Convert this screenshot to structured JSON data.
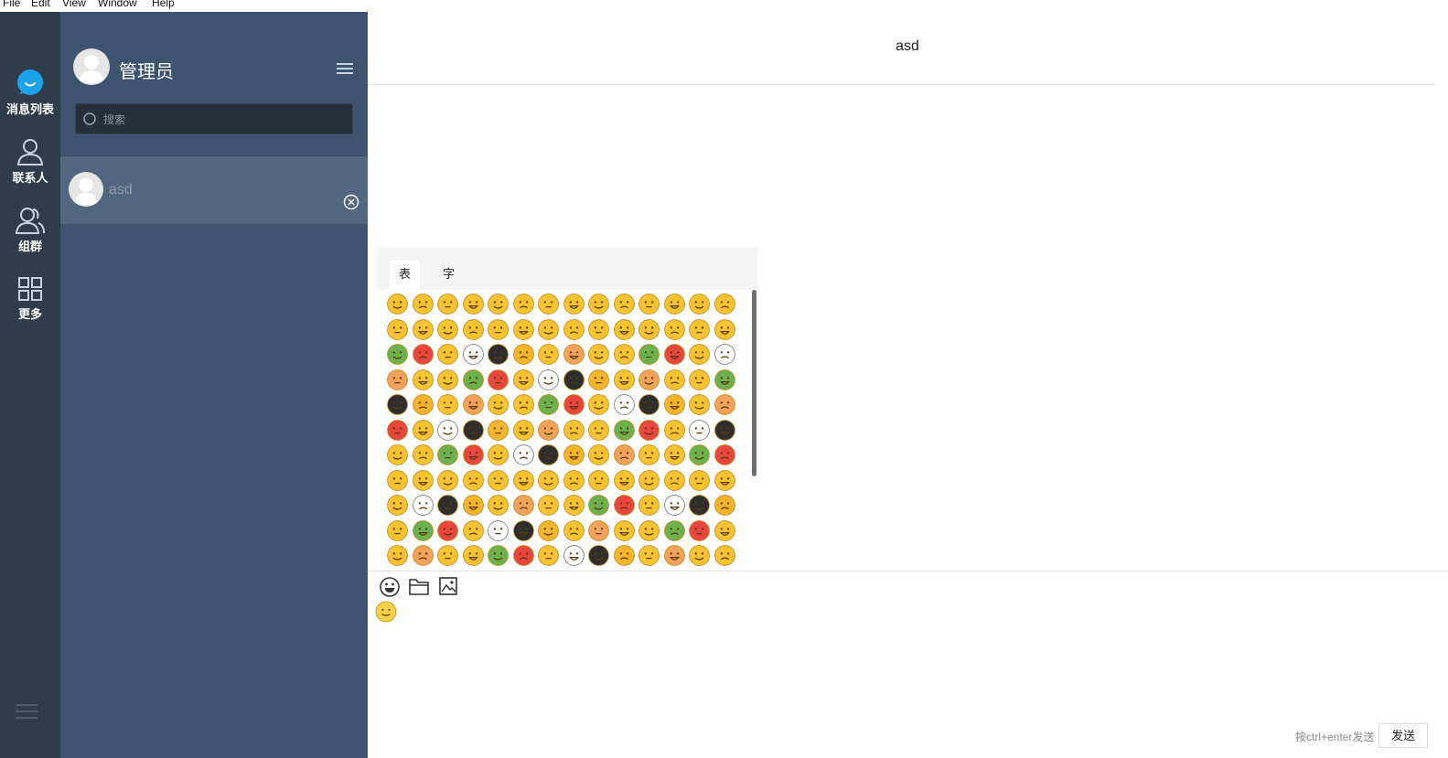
{
  "menu": [
    "File",
    "Edit",
    "View",
    "Window",
    "Help"
  ],
  "nav": {
    "items": [
      {
        "label": "消息列表",
        "icon": "chat-bubble-icon"
      },
      {
        "label": "联系人",
        "icon": "person-icon"
      },
      {
        "label": "组群",
        "icon": "group-icon"
      },
      {
        "label": "更多",
        "icon": "grid-icon"
      }
    ],
    "bottom_icon": "hamburger-icon"
  },
  "sidebar": {
    "user_name": "管理员",
    "search_placeholder": "搜索",
    "conversations": [
      {
        "name": "asd"
      }
    ]
  },
  "chat": {
    "title": "asd",
    "emoji_tabs": [
      "表情",
      "字符表情"
    ],
    "send_hint": "按ctrl+enter发送",
    "send_label": "发送"
  },
  "colors": {
    "nav_bg": "#2f3c4c",
    "sidebar_bg": "#3d5370",
    "active_conversation": "#53667f",
    "accent": "#1aa3e8",
    "emoji_yellow": "#f7c331"
  }
}
